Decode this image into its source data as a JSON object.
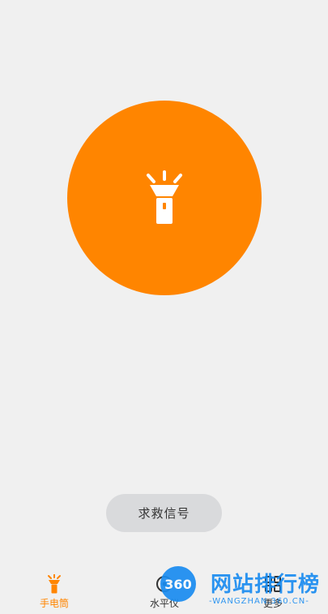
{
  "colors": {
    "accent": "#ff8500",
    "background": "#f0f0f0",
    "sos_button_bg": "#d9dadc",
    "watermark_blue": "#1a8cf0"
  },
  "torch": {
    "icon": "flashlight-icon"
  },
  "sos": {
    "label": "求救信号"
  },
  "tabs": [
    {
      "label": "手电筒",
      "icon": "flashlight-icon",
      "active": true
    },
    {
      "label": "水平仪",
      "icon": "level-icon",
      "active": false
    },
    {
      "label": "更多",
      "icon": "grid-icon",
      "active": false
    }
  ],
  "watermark": {
    "logo_text": "360",
    "title": "网站排行榜",
    "url": "-WANGZHAN.360.CN-"
  }
}
